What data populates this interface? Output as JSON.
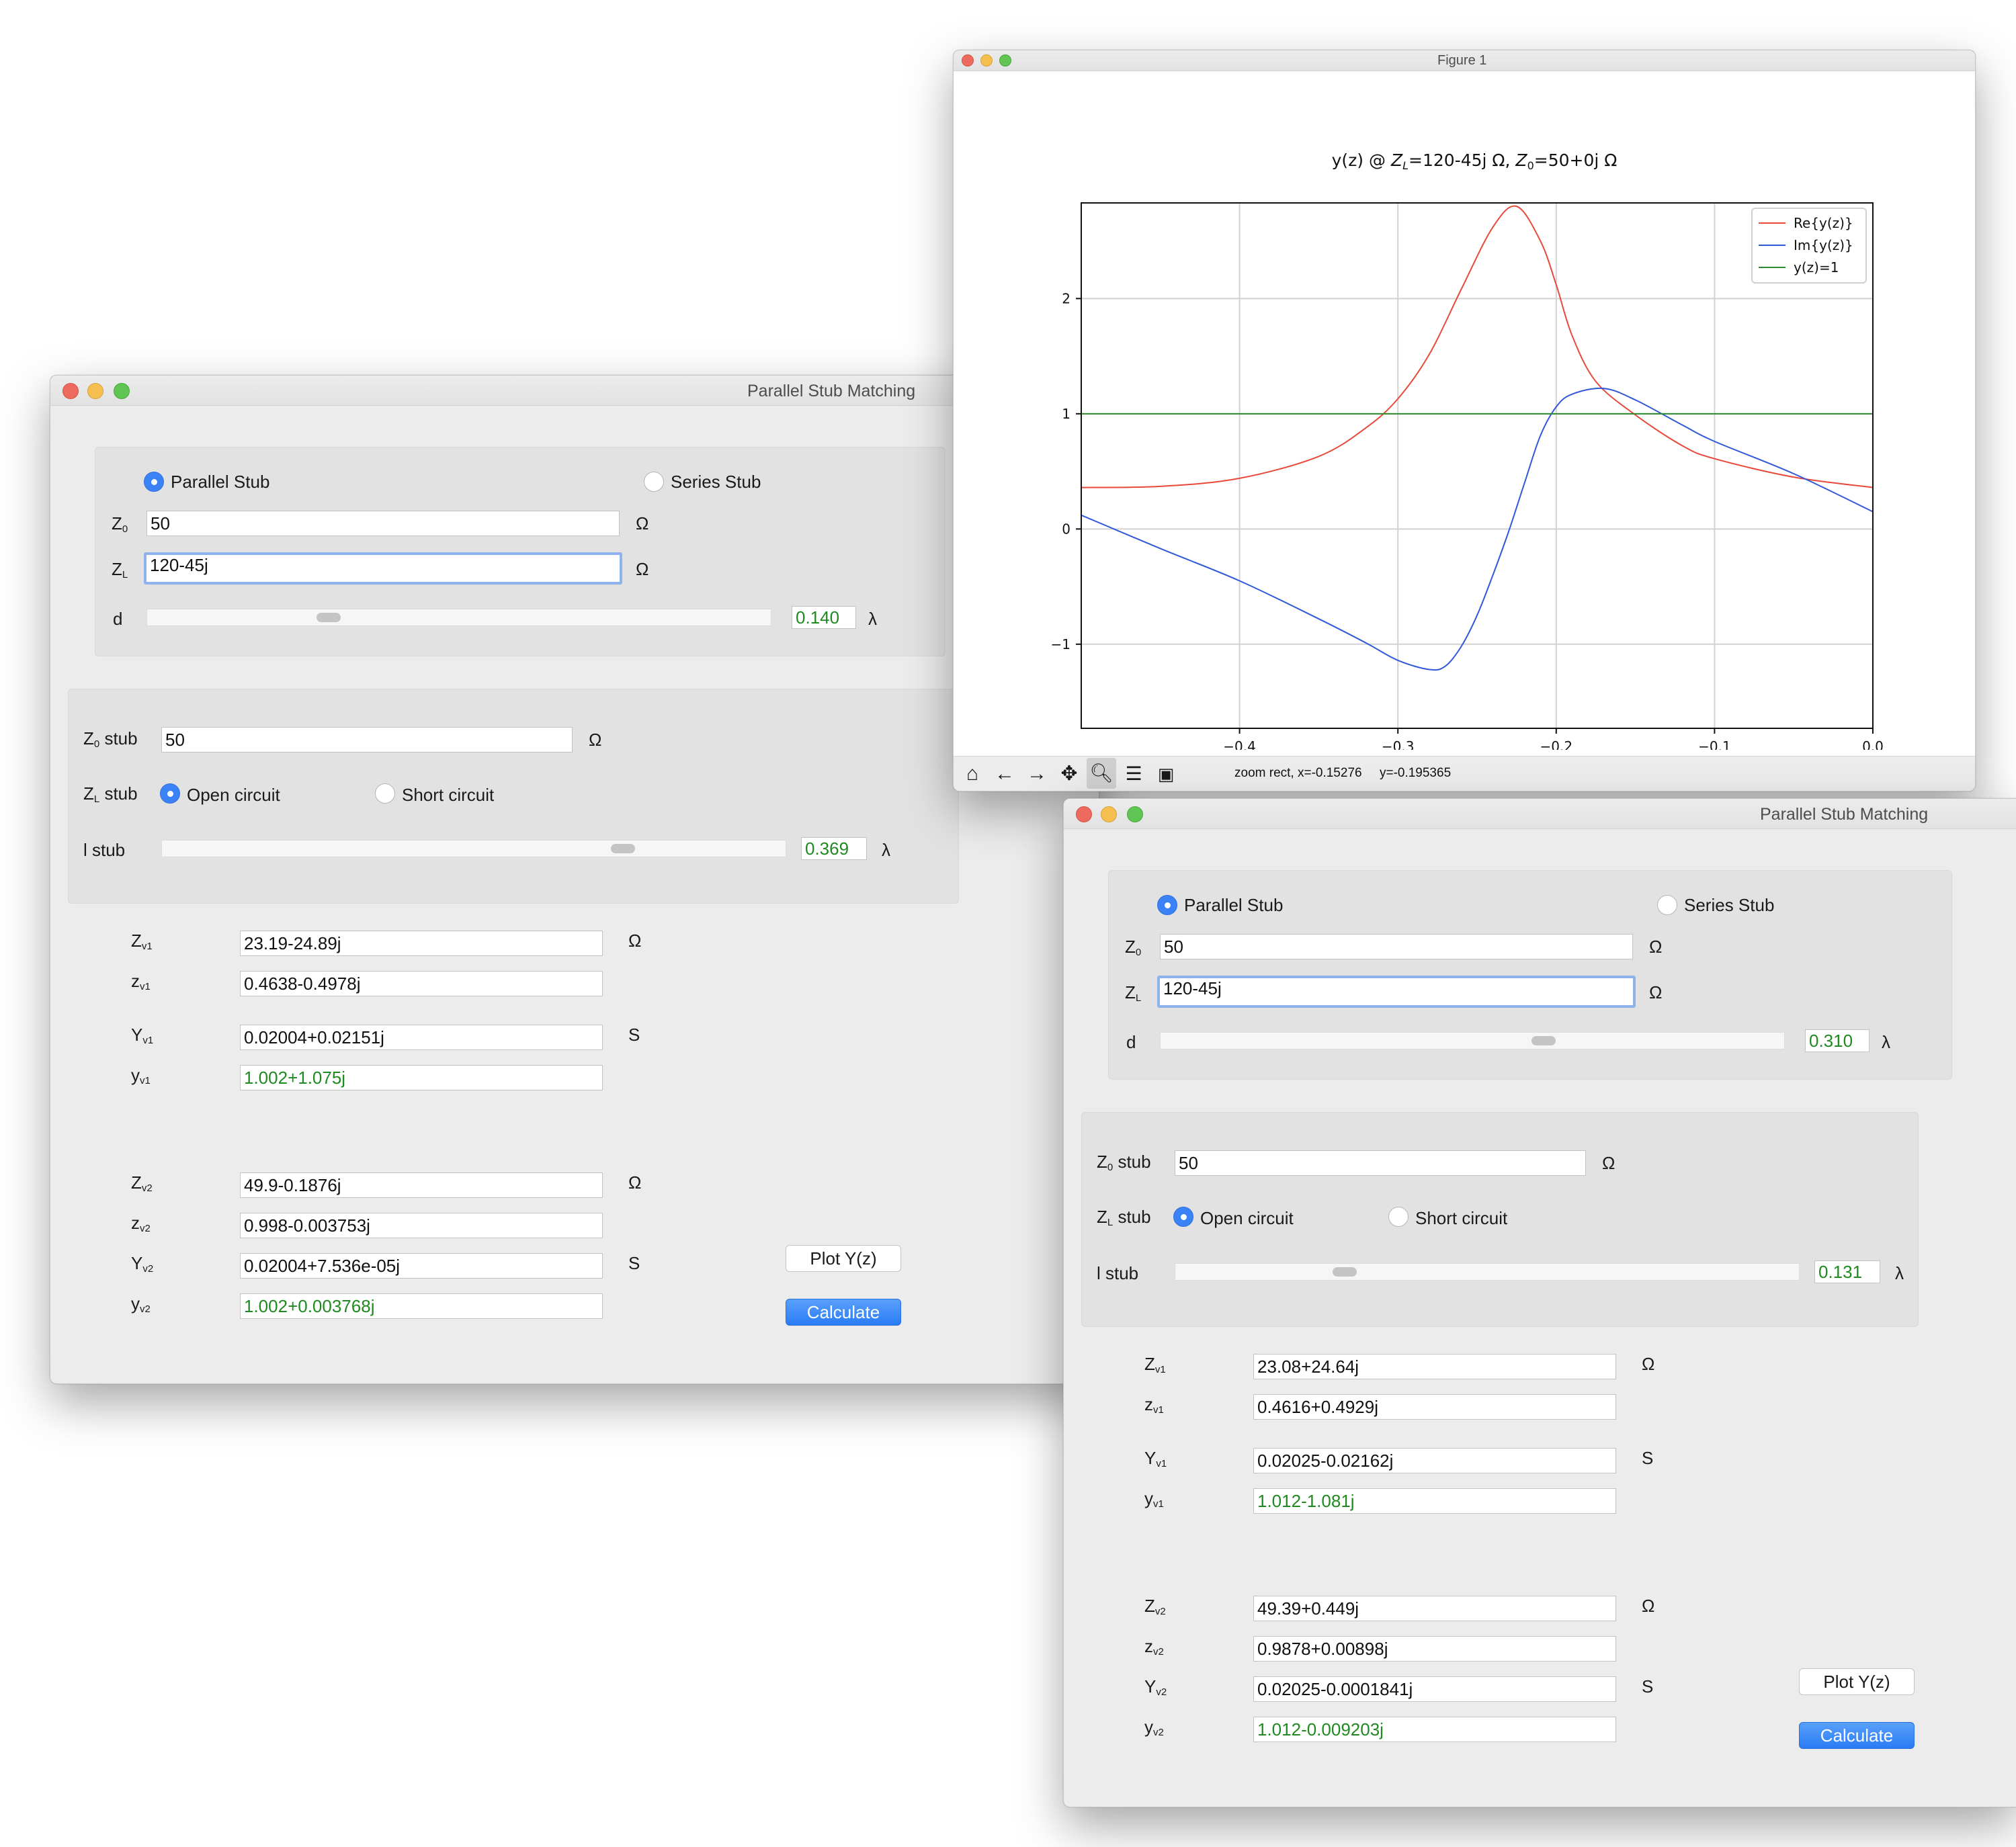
{
  "figure_window": {
    "title": "Figure 1",
    "status_text": "zoom rect, x=-0.15276     y=-0.195365",
    "toolbar_icons": [
      "home-icon",
      "back-arrow-icon",
      "forward-arrow-icon",
      "pan-icon",
      "zoom-icon",
      "configure-subplots-icon",
      "save-icon"
    ]
  },
  "chart_data": {
    "type": "line",
    "title": "y(z) @ Z_L=120-45j Ω, Z_0=50+0j Ω",
    "title_parts": {
      "a": "y(z) @ ",
      "zl": "Z",
      "zl_sub": "L",
      "b": "=120-45j Ω, ",
      "z0": "Z",
      "z0_sub": "0",
      "c": "=50+0j Ω"
    },
    "xlabel": "",
    "ylabel": "",
    "xlim": [
      -0.5,
      0.0
    ],
    "ylim": [
      -1.73,
      2.83
    ],
    "xticks": [
      -0.4,
      -0.3,
      -0.2,
      -0.1,
      0.0
    ],
    "xtick_labels": [
      "−0.4",
      "−0.3",
      "−0.2",
      "−0.1",
      "0.0"
    ],
    "yticks": [
      -1,
      0,
      1,
      2
    ],
    "ytick_labels": [
      "−1",
      "0",
      "1",
      "2"
    ],
    "grid": true,
    "legend_position": "top-right",
    "series": [
      {
        "name": "Re{y(z)}",
        "color": "#e8493a",
        "x": [
          -0.5,
          -0.45,
          -0.4,
          -0.35,
          -0.32,
          -0.3,
          -0.28,
          -0.26,
          -0.24,
          -0.225,
          -0.21,
          -0.2,
          -0.19,
          -0.175,
          -0.15,
          -0.12,
          -0.1,
          -0.05,
          0.0
        ],
        "y": [
          0.36,
          0.37,
          0.44,
          0.63,
          0.88,
          1.13,
          1.52,
          2.08,
          2.62,
          2.8,
          2.5,
          2.12,
          1.68,
          1.28,
          0.99,
          0.72,
          0.61,
          0.45,
          0.36
        ]
      },
      {
        "name": "Im{y(z)}",
        "color": "#3058d8",
        "x": [
          -0.5,
          -0.45,
          -0.4,
          -0.35,
          -0.32,
          -0.3,
          -0.28,
          -0.27,
          -0.26,
          -0.25,
          -0.24,
          -0.23,
          -0.22,
          -0.21,
          -0.2,
          -0.19,
          -0.17,
          -0.15,
          -0.12,
          -0.1,
          -0.05,
          0.0
        ],
        "y": [
          0.12,
          -0.17,
          -0.45,
          -0.78,
          -0.99,
          -1.14,
          -1.22,
          -1.19,
          -1.02,
          -0.75,
          -0.4,
          -0.02,
          0.4,
          0.81,
          1.06,
          1.17,
          1.22,
          1.12,
          0.9,
          0.76,
          0.48,
          0.15
        ]
      },
      {
        "name": "y(z)=1",
        "color": "#2d8a2d",
        "x": [
          -0.5,
          0.0
        ],
        "y": [
          1,
          1
        ]
      }
    ]
  },
  "calc_left": {
    "title": "Parallel Stub Matching",
    "mode_parallel": "Parallel Stub",
    "mode_series": "Series Stub",
    "z0_label": "Z",
    "z0_sub": "0",
    "z0_value": "50",
    "zl_label": "Z",
    "zl_sub": "L",
    "zl_value": "120-45j",
    "ohm": "Ω",
    "d_label": "d",
    "d_value": "0.140",
    "lambda": "λ",
    "d_fraction": 0.28,
    "z0_stub_label": "Z",
    "z0_stub_sub": "0",
    "z0_stub_suffix": " stub",
    "z0_stub_value": "50",
    "zl_stub_label": "Z",
    "zl_stub_sub": "L",
    "zl_stub_suffix": " stub",
    "open_circuit": "Open circuit",
    "short_circuit": "Short circuit",
    "l_stub_label": "l stub",
    "l_stub_value": "0.369",
    "l_fraction": 0.74,
    "siemens": "S",
    "r1": {
      "Zv_label": "Z",
      "Zv_sub": "v1",
      "Zv": "23.19-24.89j",
      "zv_label": "z",
      "zv_sub": "v1",
      "zv": "0.4638-0.4978j",
      "Yv_label": "Y",
      "Yv_sub": "v1",
      "Yv": "0.02004+0.02151j",
      "yv_label": "y",
      "yv_sub": "v1",
      "yv": "1.002+1.075j"
    },
    "r2": {
      "Zv_label": "Z",
      "Zv_sub": "v2",
      "Zv": "49.9-0.1876j",
      "zv_label": "z",
      "zv_sub": "v2",
      "zv": "0.998-0.003753j",
      "Yv_label": "Y",
      "Yv_sub": "v2",
      "Yv": "0.02004+7.536e-05j",
      "yv_label": "y",
      "yv_sub": "v2",
      "yv": "1.002+0.003768j"
    },
    "plot_button": "Plot Y(z)",
    "calculate_button": "Calculate"
  },
  "calc_right": {
    "title": "Parallel Stub Matching",
    "mode_parallel": "Parallel Stub",
    "mode_series": "Series Stub",
    "z0_label": "Z",
    "z0_sub": "0",
    "z0_value": "50",
    "zl_label": "Z",
    "zl_sub": "L",
    "zl_value": "120-45j",
    "ohm": "Ω",
    "d_label": "d",
    "d_value": "0.310",
    "lambda": "λ",
    "d_fraction": 0.62,
    "z0_stub_label": "Z",
    "z0_stub_sub": "0",
    "z0_stub_suffix": " stub",
    "z0_stub_value": "50",
    "zl_stub_label": "Z",
    "zl_stub_sub": "L",
    "zl_stub_suffix": " stub",
    "open_circuit": "Open circuit",
    "short_circuit": "Short circuit",
    "l_stub_label": "l stub",
    "l_stub_value": "0.131",
    "l_fraction": 0.26,
    "siemens": "S",
    "r1": {
      "Zv_label": "Z",
      "Zv_sub": "v1",
      "Zv": "23.08+24.64j",
      "zv_label": "z",
      "zv_sub": "v1",
      "zv": "0.4616+0.4929j",
      "Yv_label": "Y",
      "Yv_sub": "v1",
      "Yv": "0.02025-0.02162j",
      "yv_label": "y",
      "yv_sub": "v1",
      "yv": "1.012-1.081j"
    },
    "r2": {
      "Zv_label": "Z",
      "Zv_sub": "v2",
      "Zv": "49.39+0.449j",
      "zv_label": "z",
      "zv_sub": "v2",
      "zv": "0.9878+0.00898j",
      "Yv_label": "Y",
      "Yv_sub": "v2",
      "Yv": "0.02025-0.0001841j",
      "yv_label": "y",
      "yv_sub": "v2",
      "yv": "1.012-0.009203j"
    },
    "plot_button": "Plot Y(z)",
    "calculate_button": "Calculate"
  }
}
